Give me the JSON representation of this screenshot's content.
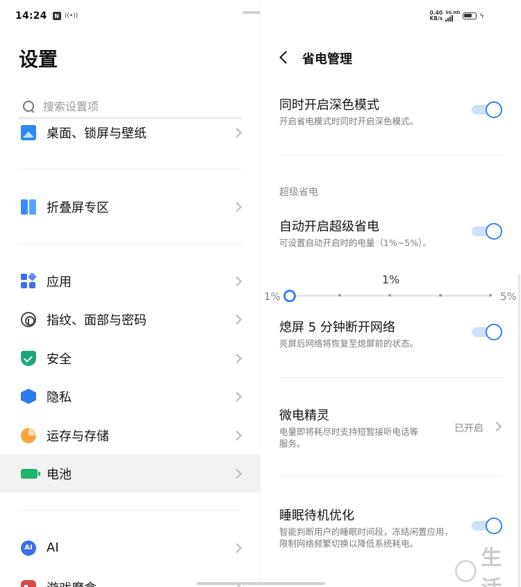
{
  "status": {
    "time": "14:24",
    "sim_badge": "N",
    "net_speed_value": "0.40",
    "net_speed_unit": "KB/s",
    "signal_label": "5G HD"
  },
  "left_pane": {
    "title": "设置",
    "search_placeholder": "搜索设置项",
    "items": [
      {
        "label": "桌面、锁屏与壁纸",
        "icon": "wallpaper-icon"
      },
      {
        "label": "折叠屏专区",
        "icon": "foldable-icon"
      },
      {
        "label": "应用",
        "icon": "apps-icon"
      },
      {
        "label": "指纹、面部与密码",
        "icon": "fingerprint-icon"
      },
      {
        "label": "安全",
        "icon": "shield-icon"
      },
      {
        "label": "隐私",
        "icon": "privacy-icon"
      },
      {
        "label": "运存与存储",
        "icon": "storage-icon"
      },
      {
        "label": "电池",
        "icon": "battery-icon",
        "selected": true
      },
      {
        "label": "AI",
        "icon": "ai-icon",
        "icon_text": "AI"
      },
      {
        "label": "游戏魔盒",
        "icon": "game-icon"
      }
    ]
  },
  "right_pane": {
    "title": "省电管理",
    "dark_mode": {
      "title": "同时开启深色模式",
      "desc": "开启省电模式时同时开启深色模式。",
      "enabled": true
    },
    "section_super_saver": "超级省电",
    "auto_super_saver": {
      "title": "自动开启超级省电",
      "desc": "可设置自动开启时的电量（1%~5%）。",
      "enabled": true
    },
    "slider": {
      "value_label": "1%",
      "min_label": "1%",
      "max_label": "5%",
      "value": 1,
      "min": 1,
      "max": 5
    },
    "screen_off_network": {
      "title": "熄屏 5 分钟断开网络",
      "desc": "亮屏后网络将恢复至熄屏前的状态。",
      "enabled": true
    },
    "micro_power": {
      "title": "微电精灵",
      "desc_line1": "电量即将耗尽时支持短暂接听电话等",
      "desc_line2": "服务。",
      "status": "已开启"
    },
    "sleep_standby": {
      "title": "睡眠待机优化",
      "desc_line1": "智能判断用户的睡眠时间段，冻结闲置应用，",
      "desc_line2": "限制网络频繁切换以降低系统耗电。",
      "enabled": true
    }
  },
  "watermark": {
    "text": "生活"
  },
  "colors": {
    "accent": "#3a7ff0",
    "toggle_track": "#cfe0fb",
    "selected_row": "#f2f2f2"
  }
}
